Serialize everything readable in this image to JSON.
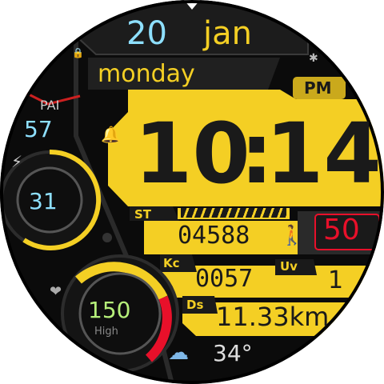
{
  "date": {
    "day": "20",
    "month": "jan",
    "weekday": "monday"
  },
  "time": {
    "hours": "10",
    "minutes": "14",
    "ampm": "PM"
  },
  "pai": {
    "label": "PAI",
    "value": "57"
  },
  "battery": {
    "value": "31",
    "level": 0.31
  },
  "steps": {
    "label": "ST",
    "value": "04588"
  },
  "target": {
    "value": "50"
  },
  "calories": {
    "label": "Kc",
    "value": "0057"
  },
  "uv": {
    "label": "Uv",
    "value": "1"
  },
  "distance": {
    "label": "Ds",
    "value": "11.33km"
  },
  "heart_rate": {
    "value": "150",
    "zone": "High"
  },
  "weather": {
    "temperature": "34°",
    "icon": "cloud-rain-icon"
  },
  "icons": {
    "lock": "lock-icon",
    "bluetooth": "bluetooth-icon",
    "alarm": "bell-icon",
    "battery": "lightning-icon",
    "walk": "walking-icon",
    "heart": "heart-icon"
  },
  "colors": {
    "accent": "#f4cf24",
    "date_day": "#8ee0ff",
    "alert": "#e8102a",
    "heart_value": "#b6f07a",
    "battery_value": "#8ee0ff"
  }
}
